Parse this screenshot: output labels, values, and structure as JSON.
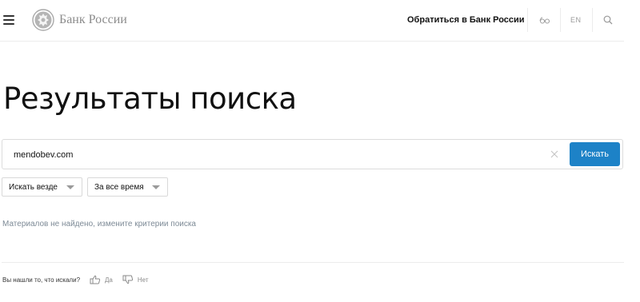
{
  "header": {
    "logo_text": "Банк России",
    "contact_link": "Обратиться в Банк России",
    "lang": "EN"
  },
  "page": {
    "title": "Результаты поиска"
  },
  "search": {
    "value": "mendobev.com",
    "button_label": "Искать"
  },
  "filters": {
    "scope_label": "Искать везде",
    "period_label": "За все время"
  },
  "results": {
    "empty_message": "Материалов не найдено, измените критерии поиска"
  },
  "feedback": {
    "question": "Вы нашли то, что искали?",
    "yes_label": "Да",
    "no_label": "Нет"
  },
  "colors": {
    "accent": "#1d82c7",
    "muted_text": "#7d8a96"
  },
  "icons": [
    "menu-icon",
    "bank-emblem-icon",
    "glasses-icon",
    "search-icon",
    "clear-icon",
    "chevron-down-icon",
    "thumbs-up-icon",
    "thumbs-down-icon"
  ]
}
